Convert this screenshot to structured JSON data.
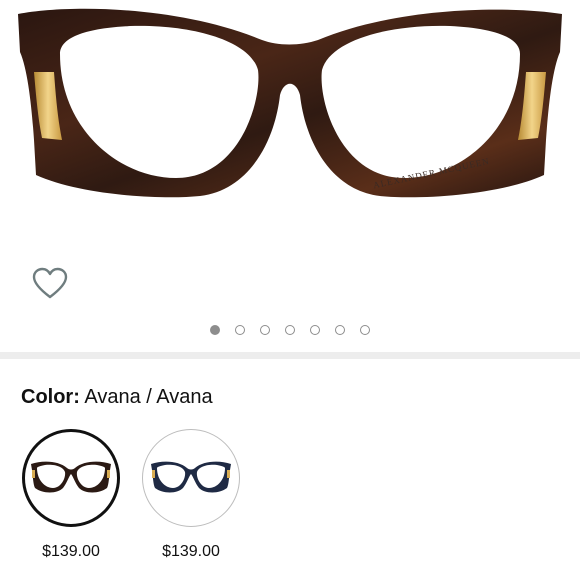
{
  "product": {
    "brand_mark": "ALEXANDER MCQUEEN",
    "frame_color_hex": "#3a1f14",
    "accent_hex": "#d9ad52"
  },
  "gallery": {
    "image_count": 7,
    "active_index": 0,
    "wishlist_icon": "heart-outline-icon"
  },
  "color_selector": {
    "label": "Color:",
    "value": "Avana / Avana",
    "options": [
      {
        "price": "$139.00",
        "selected": true,
        "frame_hex": "#2b1a14"
      },
      {
        "price": "$139.00",
        "selected": false,
        "frame_hex": "#1f2a44"
      }
    ]
  }
}
